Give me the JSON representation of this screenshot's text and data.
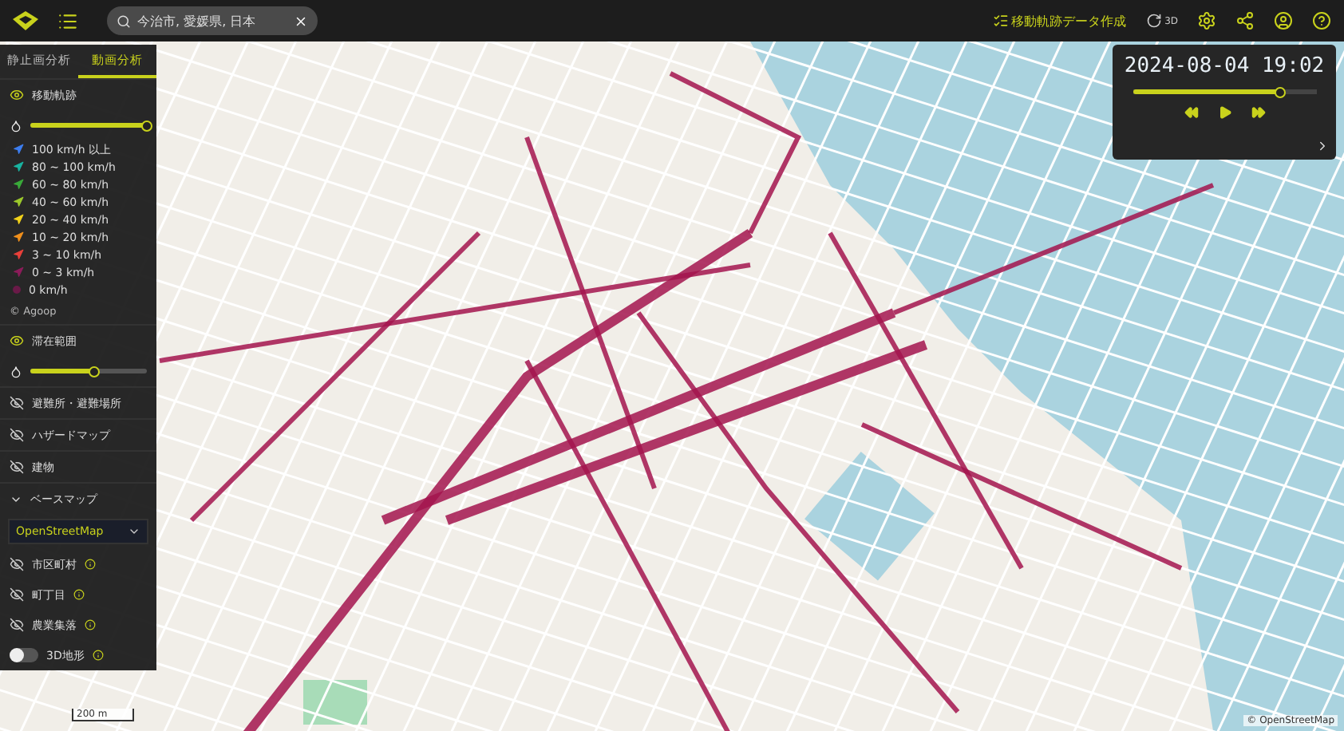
{
  "search": {
    "value": "今治市, 愛媛県, 日本"
  },
  "toolbar": {
    "create_label": "移動軌跡データ作成",
    "view_3d_label": "3D"
  },
  "tabs": [
    {
      "label": "静止画分析",
      "selected": false
    },
    {
      "label": "動画分析",
      "selected": true
    }
  ],
  "trajectory": {
    "label": "移動軌跡",
    "visible": true,
    "opacity": {
      "level": 1.0
    }
  },
  "legend": [
    {
      "kind": "arrow",
      "label": "100 km/h 以上",
      "color": "#3d7ef0"
    },
    {
      "kind": "arrow",
      "label": "80 ~ 100 km/h",
      "color": "#19b3a0"
    },
    {
      "kind": "arrow",
      "label": "60 ~ 80 km/h",
      "color": "#3aaa3a"
    },
    {
      "kind": "arrow",
      "label": "40 ~ 60 km/h",
      "color": "#9cc92c"
    },
    {
      "kind": "arrow",
      "label": "20 ~ 40 km/h",
      "color": "#f2d21a"
    },
    {
      "kind": "arrow",
      "label": "10 ~ 20 km/h",
      "color": "#f0901c"
    },
    {
      "kind": "arrow",
      "label": "3 ~ 10 km/h",
      "color": "#e8403a"
    },
    {
      "kind": "arrow",
      "label": "0 ~ 3 km/h",
      "color": "#8c1c5a"
    },
    {
      "kind": "dot",
      "label": "0 km/h",
      "color": "#6a1a48"
    }
  ],
  "credit": "© Agoop",
  "stay": {
    "label": "滞在範囲",
    "visible": true,
    "opacity": {
      "level": 0.55
    }
  },
  "layers": [
    {
      "label": "避難所・避難場所",
      "visible": false
    },
    {
      "label": "ハザードマップ",
      "visible": false
    },
    {
      "label": "建物",
      "visible": false
    }
  ],
  "basemap": {
    "label": "ベースマップ",
    "expanded": true,
    "select": "OpenStreetMap",
    "layers": [
      {
        "label": "市区町村",
        "visible": false
      },
      {
        "label": "町丁目",
        "visible": false
      },
      {
        "label": "農業集落",
        "visible": false
      }
    ],
    "terrain": {
      "label": "3D地形",
      "on": false
    }
  },
  "player": {
    "datetime": "2024-08-04 19:02",
    "progress": {
      "level": 0.8
    }
  },
  "map": {
    "scale": "200 m",
    "attribution": "© OpenStreetMap"
  }
}
